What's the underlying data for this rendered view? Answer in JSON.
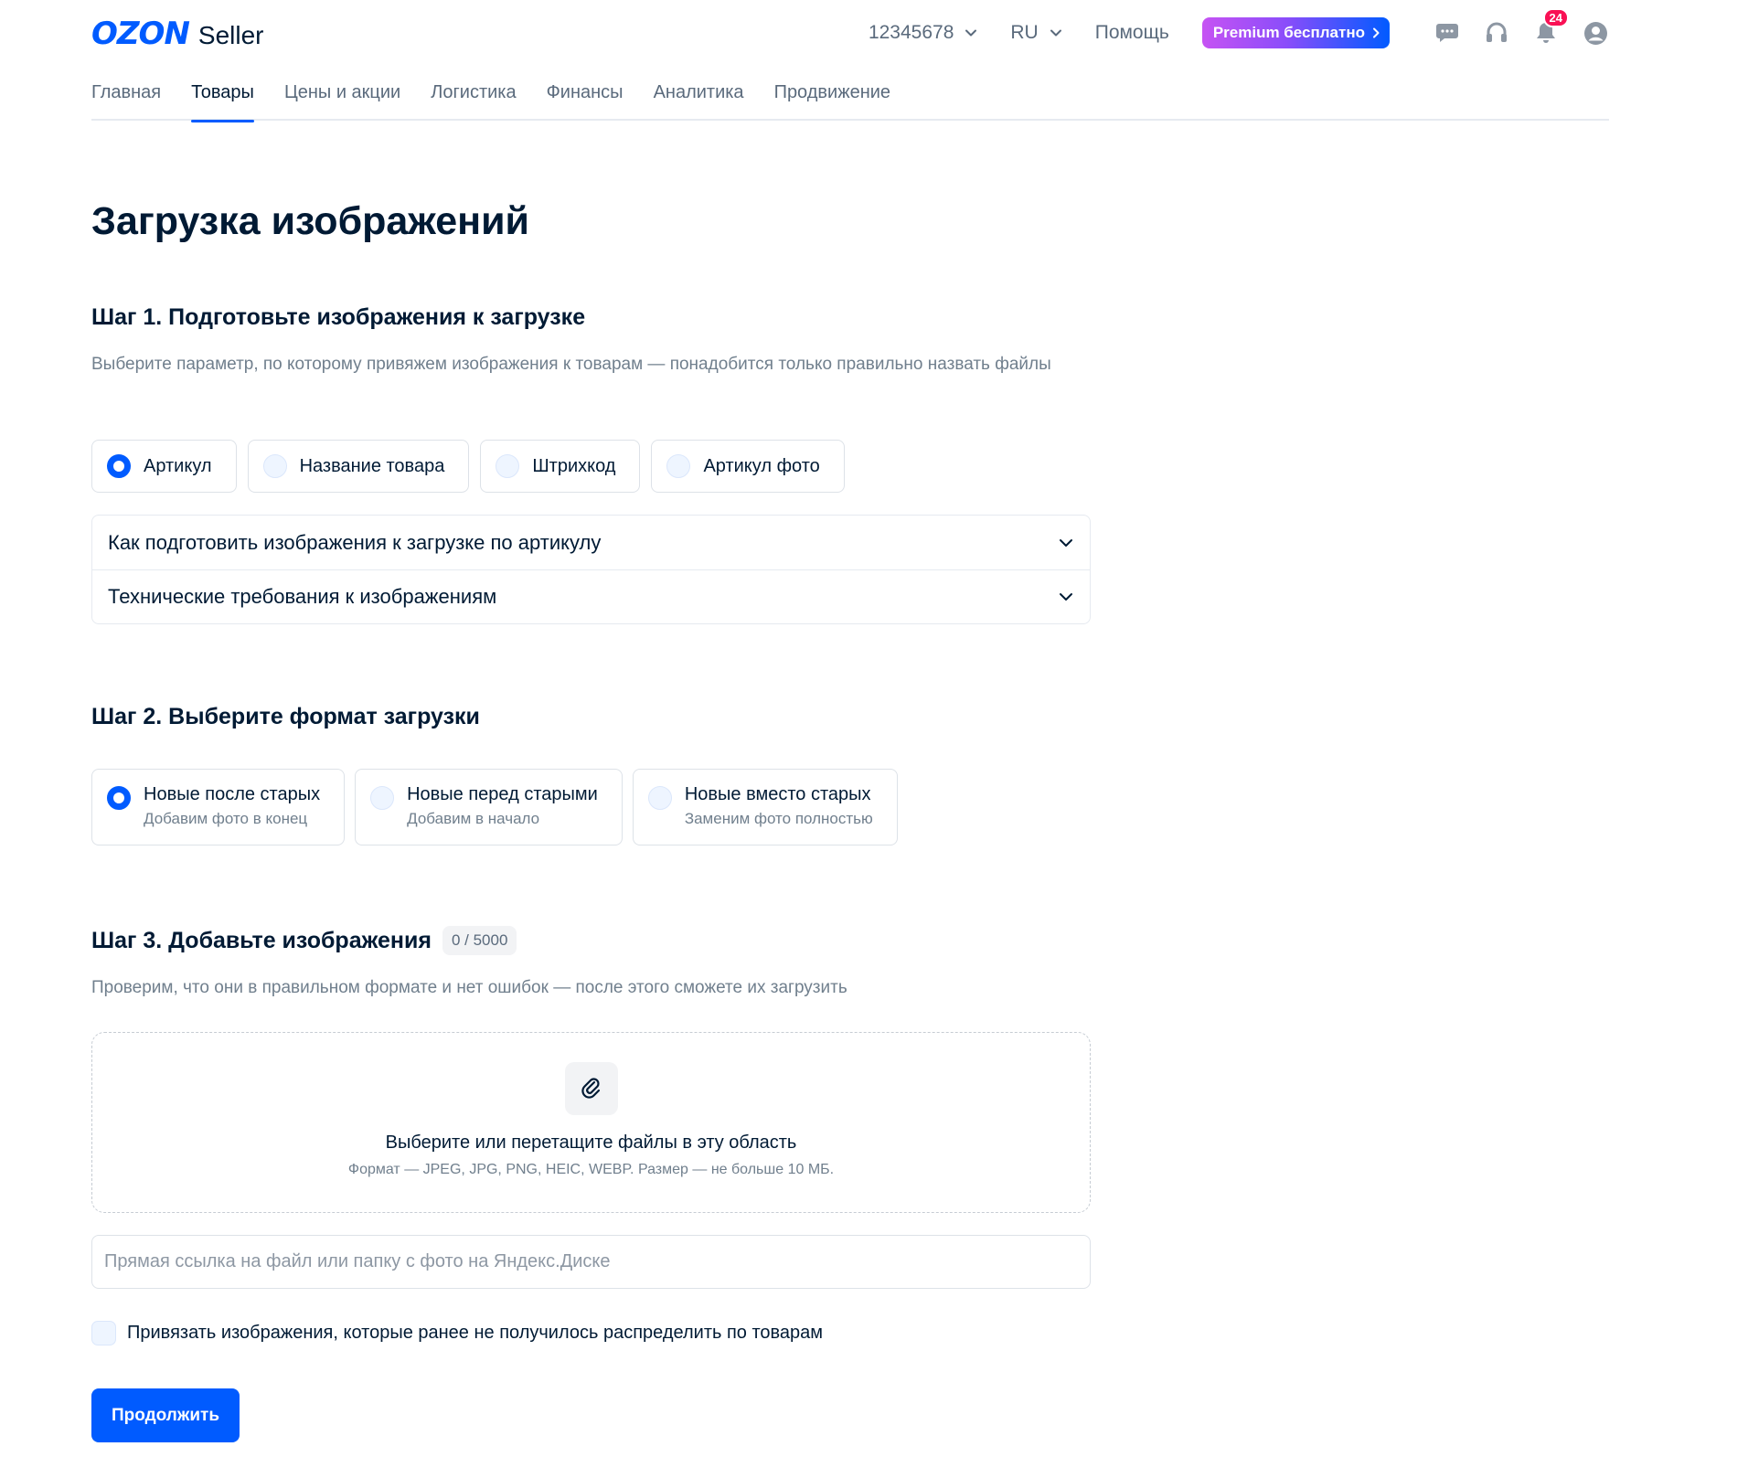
{
  "header": {
    "logo_brand": "OZON",
    "logo_suffix": "Seller",
    "account_id": "12345678",
    "language": "RU",
    "help": "Помощь",
    "premium": "Premium бесплатно",
    "notifications_count": "24"
  },
  "nav": {
    "items": [
      "Главная",
      "Товары",
      "Цены и акции",
      "Логистика",
      "Финансы",
      "Аналитика",
      "Продвижение"
    ],
    "active": "Товары"
  },
  "page": {
    "title": "Загрузка изображений"
  },
  "step1": {
    "title": "Шаг 1. Подготовьте изображения к загрузке",
    "desc": "Выберите параметр, по которому привяжем изображения к товарам — понадобится только правильно назвать файлы",
    "options": [
      "Артикул",
      "Название товара",
      "Штрихкод",
      "Артикул фото"
    ],
    "selected": "Артикул",
    "accordion": [
      "Как подготовить изображения к загрузке по артикулу",
      "Технические требования к изображениям"
    ]
  },
  "step2": {
    "title": "Шаг 2. Выберите формат загрузки",
    "options": [
      {
        "label": "Новые после старых",
        "sub": "Добавим фото в конец"
      },
      {
        "label": "Новые перед старыми",
        "sub": "Добавим в начало"
      },
      {
        "label": "Новые вместо старых",
        "sub": "Заменим фото полностью"
      }
    ],
    "selected": "Новые после старых"
  },
  "step3": {
    "title": "Шаг 3. Добавьте изображения",
    "counter": "0 / 5000",
    "desc": "Проверим, что они в правильном формате и нет ошибок — после этого сможете их загрузить",
    "dropzone_title": "Выберите или перетащите файлы в эту область",
    "dropzone_sub": "Формат — JPEG, JPG, PNG, HEIC, WEBP. Размер — не больше 10 МБ.",
    "link_placeholder": "Прямая ссылка на файл или папку с фото на Яндекс.Диске",
    "link_value": "",
    "checkbox_label": "Привязать изображения, которые ранее не получилось распределить по товарам",
    "checkbox_checked": false,
    "continue": "Продолжить"
  },
  "colors": {
    "accent": "#005bff",
    "badge": "#f91155",
    "muted_text": "#707f8d"
  }
}
